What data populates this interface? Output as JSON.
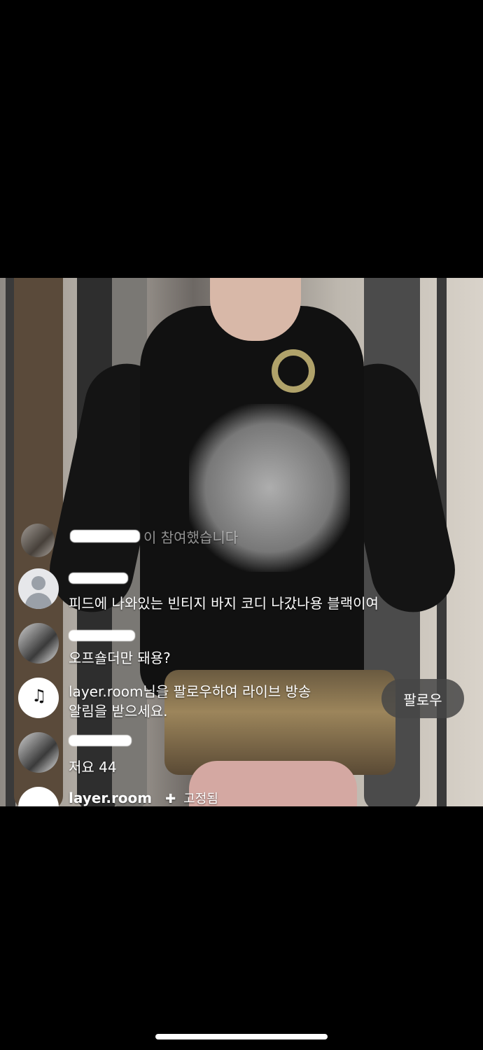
{
  "chat": {
    "join_notice": "이 참여했습니다",
    "messages": [
      {
        "text": "피드에 나와있는 빈티지 바지 코디 나갔나용 블랙이여"
      },
      {
        "text": "오프숄더만 돼용?"
      },
      {
        "text": "저요 44"
      }
    ],
    "follow_prompt": {
      "line1": "layer.room님을 팔로우하여 라이브 방송",
      "line2": "알림을 받으세요.",
      "button": "팔로우"
    },
    "pinned": {
      "user": "layer.room",
      "label": "고정됨"
    }
  },
  "icons": [
    "person-icon",
    "bell-icon",
    "pin-icon"
  ]
}
